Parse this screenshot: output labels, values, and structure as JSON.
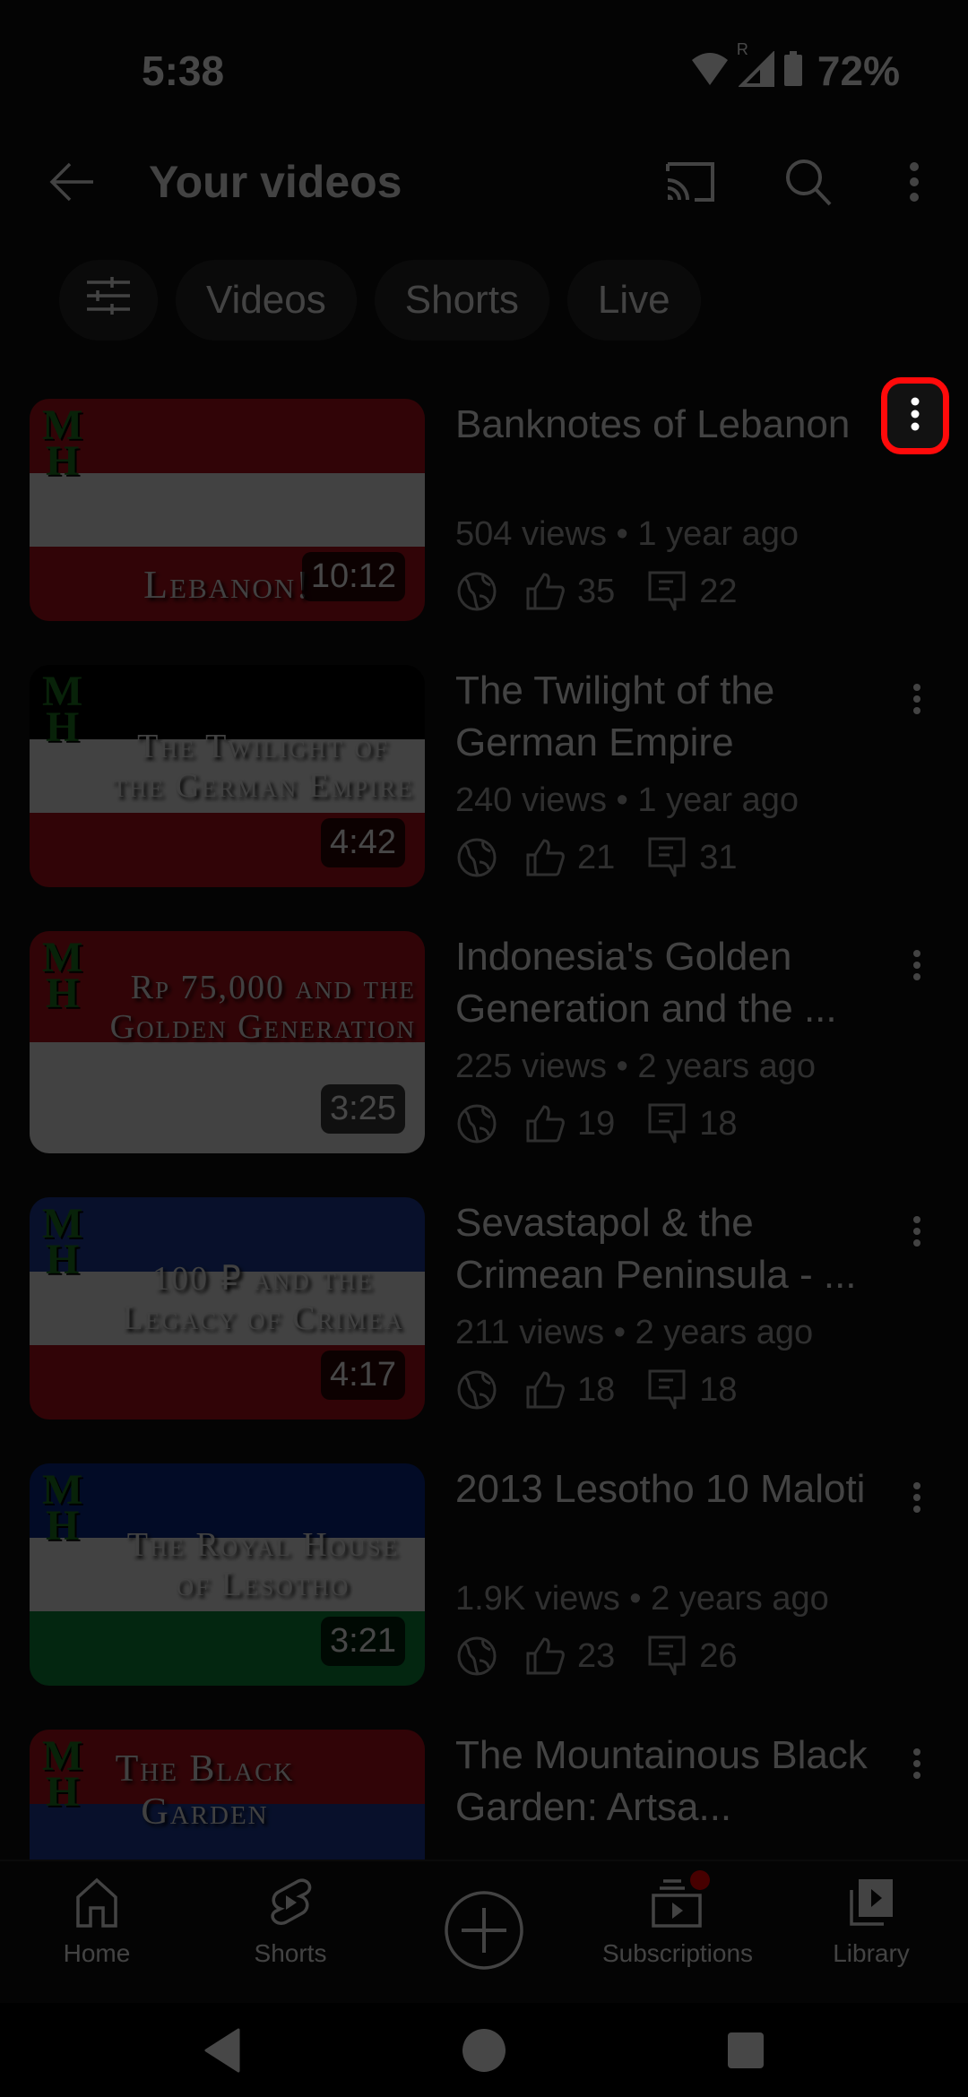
{
  "status_bar": {
    "time": "5:38",
    "battery": "72%",
    "icons": [
      "wifi-icon",
      "signal-roaming-icon",
      "battery-icon"
    ],
    "roaming_label": "R"
  },
  "app_bar": {
    "title": "Your videos",
    "icons": [
      "back-arrow-icon",
      "cast-icon",
      "search-icon",
      "more-vert-icon"
    ]
  },
  "chips": [
    {
      "label": "",
      "icon": "filter-sliders-icon"
    },
    {
      "label": "Videos"
    },
    {
      "label": "Shorts"
    },
    {
      "label": "Live"
    }
  ],
  "videos": [
    {
      "title": "Banknotes of Lebanon",
      "views": "504 views",
      "age": "1 year ago",
      "meta": "504 views • 1 year ago",
      "visibility": "public",
      "likes": "35",
      "comments": "22",
      "duration": "10:12",
      "thumb_text": "Lebanon!",
      "thumb_colors": [
        "#b0101a",
        "#ededed",
        "#b0101a"
      ]
    },
    {
      "title": "The Twilight of the German Empire",
      "views": "240 views",
      "age": "1 year ago",
      "meta": "240 views • 1 year ago",
      "visibility": "public",
      "likes": "21",
      "comments": "31",
      "duration": "4:42",
      "thumb_text": "The Twilight of the German Empire",
      "thumb_colors": [
        "#000000",
        "#ededed",
        "#b0101a"
      ]
    },
    {
      "title": "Indonesia's Golden Generation and the ...",
      "views": "225 views",
      "age": "2 years ago",
      "meta": "225 views • 2 years ago",
      "visibility": "public",
      "likes": "19",
      "comments": "18",
      "duration": "3:25",
      "thumb_text": "Rp 75,000 and the Golden Generation",
      "thumb_colors": [
        "#b0101a",
        "#ededed"
      ]
    },
    {
      "title": "Sevastapol & the Crimean Peninsula - ...",
      "views": "211 views",
      "age": "2 years ago",
      "meta": "211 views • 2 years ago",
      "visibility": "public",
      "likes": "18",
      "comments": "18",
      "duration": "4:17",
      "thumb_text": "100 ₽ and the Legacy of Crimea",
      "thumb_colors": [
        "#1d3c9a",
        "#ededed",
        "#b0101a"
      ]
    },
    {
      "title": "2013 Lesotho 10 Maloti",
      "views": "1.9K views",
      "age": "2 years ago",
      "meta": "1.9K views • 2 years ago",
      "visibility": "public",
      "likes": "23",
      "comments": "26",
      "duration": "3:21",
      "thumb_text": "The Royal House of Lesotho",
      "thumb_colors": [
        "#0a2a8a",
        "#ededed",
        "#0b8a3a"
      ]
    },
    {
      "title": "The Mountainous Black Garden: Artsa...",
      "views": "",
      "age": "",
      "meta": "",
      "visibility": "public",
      "likes": "",
      "comments": "",
      "duration": "",
      "thumb_text": "The Black Garden",
      "thumb_colors": [
        "#b0101a",
        "#1d3c9a",
        "#e7a016"
      ]
    }
  ],
  "bottom_nav": [
    {
      "label": "Home",
      "icon": "home-icon"
    },
    {
      "label": "Shorts",
      "icon": "shorts-icon"
    },
    {
      "label": "",
      "icon": "create-plus-icon"
    },
    {
      "label": "Subscriptions",
      "icon": "subscriptions-icon",
      "badge": true
    },
    {
      "label": "Library",
      "icon": "library-icon"
    }
  ],
  "system_nav": [
    "back-triangle-icon",
    "home-circle-icon",
    "recents-square-icon"
  ],
  "highlight": {
    "target": "video-menu-button",
    "video_index": 0,
    "color": "#ff0a0a"
  },
  "colors": {
    "background": "#0f0f0f",
    "chip": "#272727",
    "text_secondary": "#aaaaaa",
    "badge": "#ff0000",
    "logo_green": "#1d7a22"
  }
}
